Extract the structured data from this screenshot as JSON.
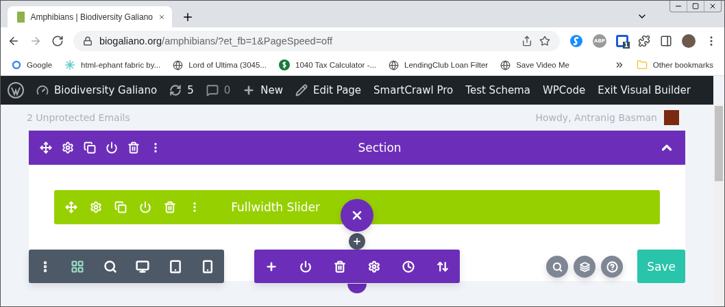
{
  "browser": {
    "tabs": [
      {
        "title": "Amphibians | Biodiversity Galiano",
        "selected": true
      }
    ],
    "address": {
      "domain": "biogaliano.org",
      "path": "/amphibians/?et_fb=1&PageSpeed=off"
    },
    "extension_badge": "1",
    "abp_label": "ABP",
    "bookmarks": [
      {
        "label": "Google",
        "kind": "google"
      },
      {
        "label": "html-ephant fabric by...",
        "kind": "snow"
      },
      {
        "label": "Lord of Ultima (3045...",
        "kind": "globe"
      },
      {
        "label": "1040 Tax Calculator -...",
        "kind": "dollar"
      },
      {
        "label": "LendingClub Loan Filter",
        "kind": "globe"
      },
      {
        "label": "Save Video Me",
        "kind": "globe"
      }
    ],
    "other_bookmarks": "Other bookmarks"
  },
  "admin_bar": [
    {
      "kind": "site",
      "label": "Biodiversity Galiano"
    },
    {
      "kind": "updates",
      "label": "5"
    },
    {
      "kind": "comments",
      "label": "0"
    },
    {
      "kind": "new",
      "label": "New"
    },
    {
      "kind": "edit",
      "label": "Edit Page"
    },
    {
      "kind": "text",
      "label": "SmartCrawl Pro"
    },
    {
      "kind": "text",
      "label": "Test Schema"
    },
    {
      "kind": "text",
      "label": "WPCode"
    },
    {
      "kind": "text",
      "label": "Exit Visual Builder"
    }
  ],
  "page_behind": {
    "left": "2 Unprotected Emails",
    "right": "Howdy, Antranig Basman"
  },
  "section": {
    "title": "Section",
    "expanded": true
  },
  "module": {
    "title": "Fullwidth Slider"
  },
  "save_button": "Save"
}
